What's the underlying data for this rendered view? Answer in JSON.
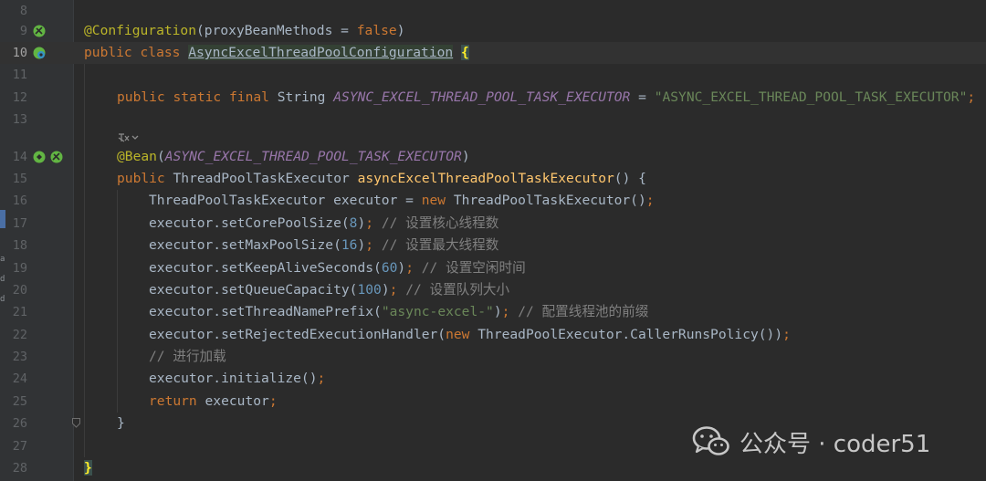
{
  "editor": {
    "lines": [
      {
        "num": "8"
      },
      {
        "num": "9"
      },
      {
        "num": "10"
      },
      {
        "num": "11"
      },
      {
        "num": "12"
      },
      {
        "num": "13"
      },
      {
        "num": ""
      },
      {
        "num": "14"
      },
      {
        "num": "15"
      },
      {
        "num": "16"
      },
      {
        "num": "17"
      },
      {
        "num": "18"
      },
      {
        "num": "19"
      },
      {
        "num": "20"
      },
      {
        "num": "21"
      },
      {
        "num": "22"
      },
      {
        "num": "23"
      },
      {
        "num": "24"
      },
      {
        "num": "25"
      },
      {
        "num": "26"
      },
      {
        "num": "27"
      },
      {
        "num": "28"
      }
    ],
    "code": {
      "l9_annotation": "@Configuration",
      "l9_param": "(proxyBeanMethods = ",
      "l9_false": "false",
      "l9_close": ")",
      "l10_public": "public ",
      "l10_class": "class ",
      "l10_name": "AsyncExcelThreadPoolConfiguration",
      "l10_brace": "{",
      "l12_mods": "public static final ",
      "l12_type": "String ",
      "l12_field": "ASYNC_EXCEL_THREAD_POOL_TASK_EXECUTOR",
      "l12_eq": " = ",
      "l12_value": "\"ASYNC_EXCEL_THREAD_POOL_TASK_EXECUTOR\"",
      "l12_semi": ";",
      "l14_annotation": "@Bean",
      "l14_open": "(",
      "l14_ref": "ASYNC_EXCEL_THREAD_POOL_TASK_EXECUTOR",
      "l14_close": ")",
      "l15_public": "public ",
      "l15_type": "ThreadPoolTaskExecutor ",
      "l15_method": "asyncExcelThreadPoolTaskExecutor",
      "l15_rest": "() {",
      "l16_decl": "ThreadPoolTaskExecutor executor = ",
      "l16_new": "new ",
      "l16_ctor": "ThreadPoolTaskExecutor()",
      "l16_semi": ";",
      "l17_call": "executor.setCorePoolSize(",
      "l17_num": "8",
      "l17_close": ")",
      "l17_semi": "; ",
      "l17_comment": "// 设置核心线程数",
      "l18_call": "executor.setMaxPoolSize(",
      "l18_num": "16",
      "l18_close": ")",
      "l18_semi": "; ",
      "l18_comment": "// 设置最大线程数",
      "l19_call": "executor.setKeepAliveSeconds(",
      "l19_num": "60",
      "l19_close": ")",
      "l19_semi": "; ",
      "l19_comment": "// 设置空闲时间",
      "l20_call": "executor.setQueueCapacity(",
      "l20_num": "100",
      "l20_close": ")",
      "l20_semi": "; ",
      "l20_comment": "// 设置队列大小",
      "l21_call": "executor.setThreadNamePrefix(",
      "l21_str": "\"async-excel-\"",
      "l21_close": ")",
      "l21_semi": "; ",
      "l21_comment": "// 配置线程池的前缀",
      "l22_call": "executor.setRejectedExecutionHandler(",
      "l22_new": "new ",
      "l22_rest": "ThreadPoolExecutor.CallerRunsPolicy())",
      "l22_semi": ";",
      "l23_comment": "// 进行加载",
      "l24_call": "executor.initialize()",
      "l24_semi": ";",
      "l25_return": "return ",
      "l25_var": "executor",
      "l25_semi": ";",
      "l26_brace": "}",
      "l28_brace": "}"
    }
  },
  "watermark": {
    "text": "公众号 · coder51"
  },
  "colors": {
    "background": "#2b2b2b",
    "gutter": "#313335",
    "keyword": "#cc7832",
    "annotation": "#bbb529",
    "string": "#6a8759",
    "number": "#6897bb",
    "comment": "#808080",
    "method_decl": "#ffc66d",
    "static_field": "#9876aa"
  },
  "icons": {
    "l9": "spring-bean-icon",
    "l10": "spring-config-icon",
    "l14_a": "run-marker-icon",
    "l14_b": "spring-bean-icon",
    "l13_hint": "inlay-hint-icon",
    "fold": "fold-marker-icon",
    "watermark": "wechat-logo-icon"
  }
}
